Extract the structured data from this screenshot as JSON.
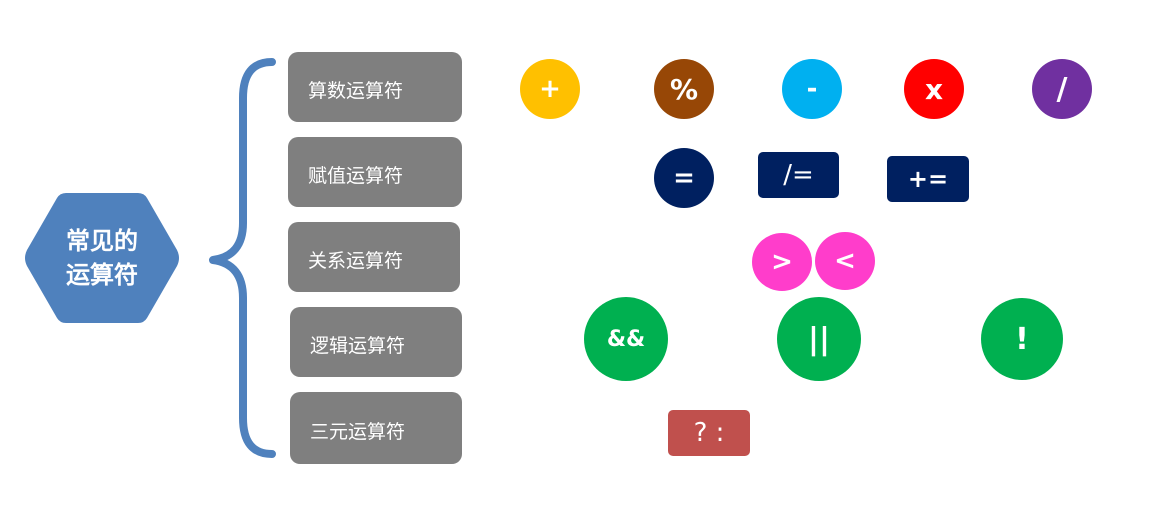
{
  "center": {
    "line1": "常见的",
    "line2": "运算符",
    "color": "#4f81bd"
  },
  "brace_color": "#4f81bd",
  "categories": [
    {
      "label": "算数运算符"
    },
    {
      "label": "赋值运算符"
    },
    {
      "label": "关系运算符"
    },
    {
      "label": "逻辑运算符"
    },
    {
      "label": "三元运算符"
    }
  ],
  "category_color": "#7f7f7f",
  "operators": {
    "arithmetic": [
      {
        "symbol": "+",
        "color": "#ffc000"
      },
      {
        "symbol": "%",
        "color": "#974706"
      },
      {
        "symbol": "-",
        "color": "#00b0f0"
      },
      {
        "symbol": "x",
        "color": "#ff0000"
      },
      {
        "symbol": "/",
        "color": "#7030a0"
      }
    ],
    "assignment": [
      {
        "symbol": "=",
        "color": "#002060"
      },
      {
        "symbol": "/=",
        "color": "#002060"
      },
      {
        "symbol": "+=",
        "color": "#002060"
      }
    ],
    "relational": [
      {
        "symbol": ">",
        "color": "#ff3dcb"
      },
      {
        "symbol": "<",
        "color": "#ff3dcb"
      }
    ],
    "logical": [
      {
        "symbol": "&&",
        "color": "#00b050"
      },
      {
        "symbol": "||",
        "color": "#00b050"
      },
      {
        "symbol": "!",
        "color": "#00b050"
      }
    ],
    "ternary": [
      {
        "symbol": "? :",
        "color": "#c0504d"
      }
    ]
  }
}
